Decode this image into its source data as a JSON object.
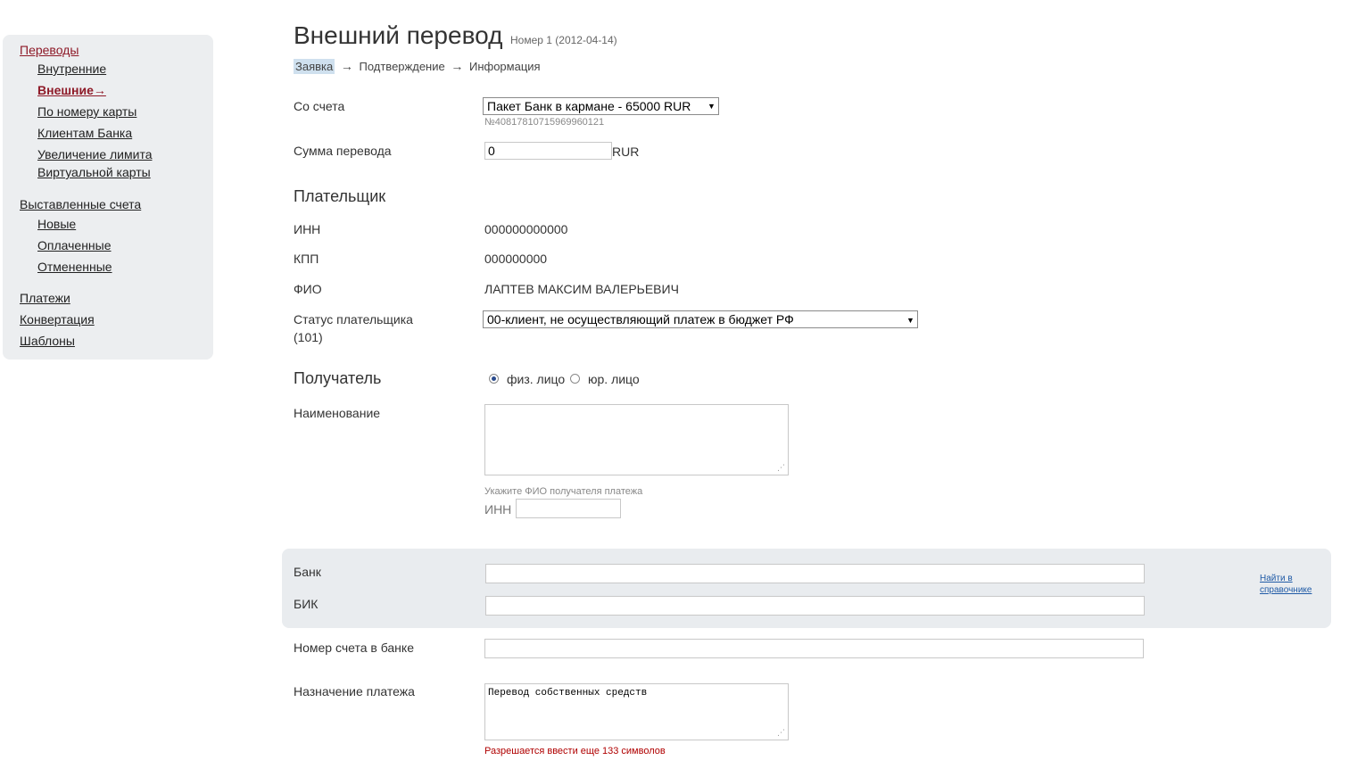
{
  "sidebar": {
    "transfers": "Переводы",
    "transfer_items": [
      "Внутренние",
      "Внешние→",
      "По номеру карты",
      "Клиентам Банка",
      "Увеличение лимита",
      "Виртуальной карты"
    ],
    "invoices": "Выставленные счета",
    "invoice_items": [
      "Новые",
      "Оплаченные",
      "Отмененные"
    ],
    "payments": "Платежи",
    "conversion": "Конвертация",
    "templates": "Шаблоны"
  },
  "page": {
    "title": "Внешний перевод",
    "subtitle": "Номер 1 (2012-04-14)",
    "steps": [
      "Заявка",
      "Подтверждение",
      "Информация"
    ],
    "arrow": "→"
  },
  "form": {
    "from_account_label": "Со счета",
    "from_account_value": "Пакет Банк в кармане - 65000 RUR",
    "account_number": "№40817810715969960121",
    "amount_label": "Сумма перевода",
    "amount_value": "0",
    "currency": "RUR",
    "payer_section": "Плательщик",
    "inn_label": "ИНН",
    "inn_value": "000000000000",
    "kpp_label": "КПП",
    "kpp_value": "000000000",
    "fio_label": "ФИО",
    "fio_value": "ЛАПТЕВ МАКСИМ ВАЛЕРЬЕВИЧ",
    "status_label_line1": "Статус плательщика",
    "status_label_line2": "(101)",
    "status_value": "00-клиент, не осуществляющий платеж в бюджет РФ",
    "recipient_section": "Получатель",
    "radio_individual": "физ. лицо",
    "radio_legal": "юр. лицо",
    "name_label": "Наименование",
    "name_hint": "Укажите ФИО получателя платежа",
    "recipient_inn_label": "ИНН",
    "bank_label": "Банк",
    "bik_label": "БИК",
    "lookup_line1": "Найти в",
    "lookup_line2": "справочнике",
    "account_in_bank_label": "Номер счета в банке",
    "purpose_label": "Назначение платежа",
    "purpose_value": "Перевод собственных средств",
    "chars_remaining": "Разрешается ввести еще 133 символов"
  }
}
